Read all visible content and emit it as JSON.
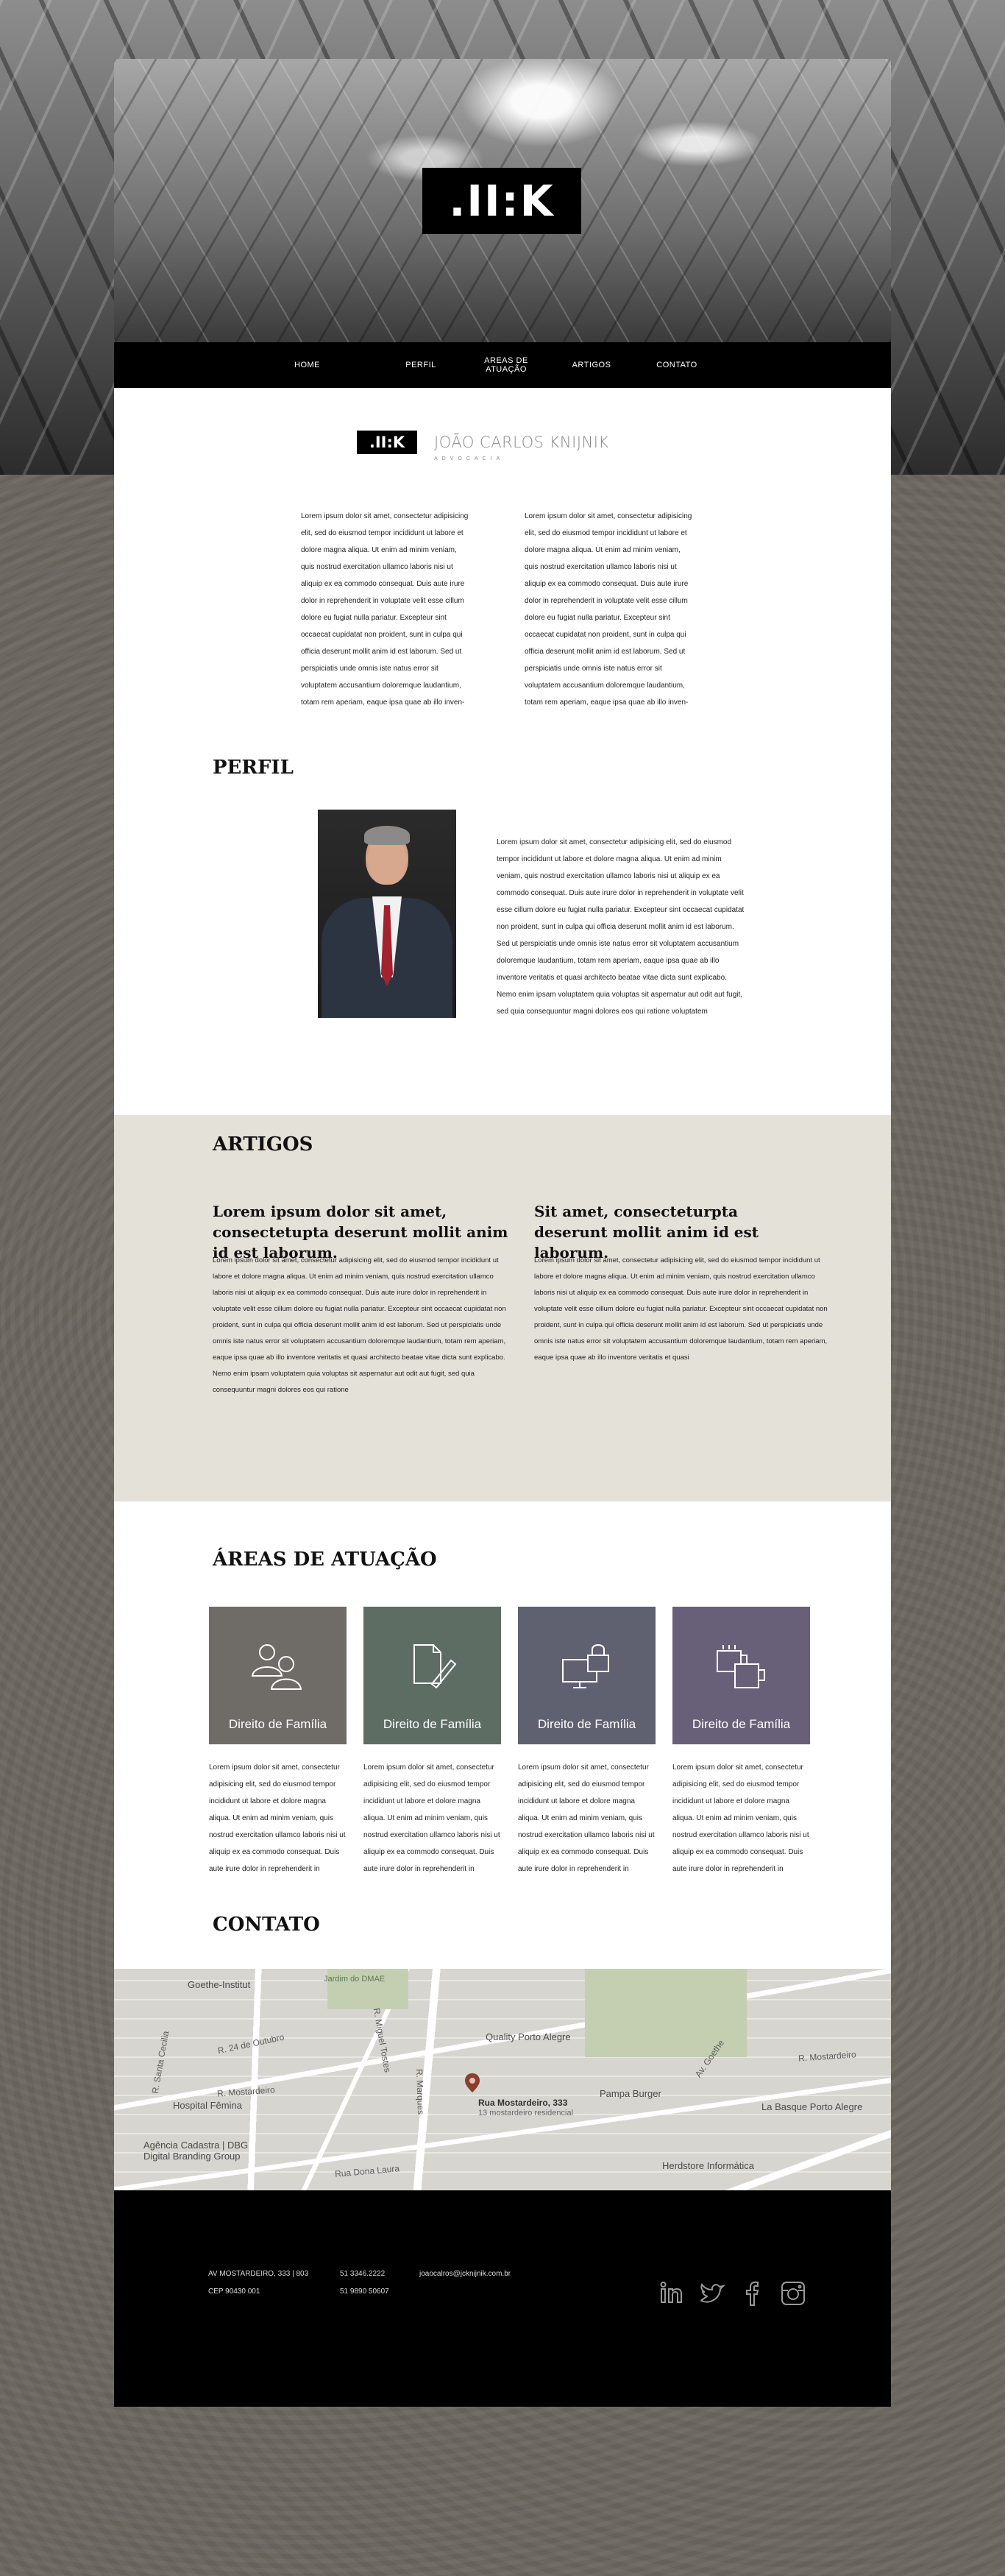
{
  "brand": {
    "logo": ".II:K",
    "name": "JOÃO CARLOS KNIJNIK",
    "subtitle": "ADVOCACIA"
  },
  "nav": [
    "HOME",
    "PERFIL",
    "AREAS DE ATUAÇÃO",
    "ARTIGOS",
    "CONTATO"
  ],
  "intro": {
    "col1": "Lorem ipsum dolor sit amet, consectetur adipisicing elit, sed do eiusmod tempor incididunt ut labore et dolore magna aliqua. Ut enim ad minim veniam, quis nostrud exercitation ullamco laboris nisi ut aliquip ex ea commodo consequat. Duis aute irure dolor in reprehenderit in voluptate velit esse cillum dolore eu fugiat nulla pariatur. Excepteur sint occaecat cupidatat non proident, sunt in culpa qui officia deserunt mollit anim id est laborum. Sed ut perspiciatis unde omnis iste natus error sit voluptatem accusantium doloremque laudantium, totam rem aperiam, eaque ipsa quae ab illo inven-",
    "col2": "Lorem ipsum dolor sit amet, consectetur adipisicing elit, sed do eiusmod tempor incididunt ut labore et dolore magna aliqua. Ut enim ad minim veniam, quis nostrud exercitation ullamco laboris nisi ut aliquip ex ea commodo consequat. Duis aute irure dolor in reprehenderit in voluptate velit esse cillum dolore eu fugiat nulla pariatur. Excepteur sint occaecat cupidatat non proident, sunt in culpa qui officia deserunt mollit anim id est laborum. Sed ut perspiciatis unde omnis iste natus error sit voluptatem accusantium doloremque laudantium, totam rem aperiam, eaque ipsa quae ab illo inven-"
  },
  "perfil": {
    "title": "PERFIL",
    "text": "Lorem ipsum dolor sit amet, consectetur adipisicing elit, sed do eiusmod tempor incididunt ut labore et dolore magna aliqua. Ut enim ad minim veniam, quis nostrud exercitation ullamco laboris nisi ut aliquip ex ea commodo consequat. Duis aute irure dolor in reprehenderit in voluptate velit esse cillum dolore eu fugiat nulla pariatur. Excepteur sint occaecat cupidatat non proident, sunt in culpa qui officia deserunt mollit anim id est laborum. Sed ut perspiciatis unde omnis iste natus error sit voluptatem accusantium doloremque laudantium, totam rem aperiam, eaque ipsa quae ab illo inventore veritatis et quasi architecto beatae vitae dicta sunt explicabo. Nemo enim ipsam voluptatem quia voluptas sit aspernatur aut odit aut fugit, sed quia consequuntur magni dolores eos qui ratione voluptatem"
  },
  "artigos": {
    "title": "ARTIGOS",
    "items": [
      {
        "title": "Lorem ipsum dolor sit amet, consectetupta  deserunt mollit anim id est laborum.",
        "text": "Lorem ipsum dolor sit amet, consectetur adipisicing elit, sed do eiusmod tempor incididunt ut labore et dolore magna aliqua. Ut enim ad minim veniam, quis nostrud exercitation ullamco laboris nisi ut aliquip ex ea commodo consequat. Duis aute irure dolor in reprehenderit in voluptate velit esse cillum dolore eu fugiat nulla pariatur. Excepteur sint occaecat cupidatat non proident, sunt in culpa qui officia deserunt mollit anim id est laborum. Sed ut perspiciatis unde omnis iste natus error sit voluptatem accusantium doloremque laudantium, totam rem aperiam, eaque ipsa quae ab illo inventore veritatis et quasi architecto beatae vitae dicta sunt explicabo. Nemo enim ipsam voluptatem quia voluptas sit aspernatur aut odit aut fugit, sed quia consequuntur magni dolores eos qui ratione"
      },
      {
        "title": "Sit amet, consecteturpta  deserunt mollit anim id est laborum.",
        "text": "Lorem ipsum dolor sit amet, consectetur adipisicing elit, sed do eiusmod tempor incididunt ut labore et dolore magna aliqua. Ut enim ad minim veniam, quis nostrud exercitation ullamco laboris nisi ut aliquip ex ea commodo consequat. Duis aute irure dolor in reprehenderit in voluptate velit esse cillum dolore eu fugiat nulla pariatur. Excepteur sint occaecat cupidatat non proident, sunt in culpa qui officia deserunt mollit anim id est laborum. Sed ut perspiciatis unde omnis iste natus error sit voluptatem accusantium doloremque laudantium, totam rem aperiam, eaque ipsa quae ab illo inventore veritatis et quasi"
      }
    ]
  },
  "areas": {
    "title": "ÁREAS DE ATUAÇÃO",
    "tiles": [
      {
        "label": "Direito de Família",
        "icon": "people-icon",
        "color": "#6f6c67",
        "text": "Lorem ipsum dolor sit amet, consectetur adipisicing elit, sed do eiusmod tempor incididunt ut labore et dolore magna aliqua. Ut enim ad minim veniam, quis nostrud exercitation ullamco laboris nisi ut aliquip ex ea commodo consequat. Duis aute irure dolor in reprehenderit in"
      },
      {
        "label": "Direito de Família",
        "icon": "document-pen-icon",
        "color": "#5d6d63",
        "text": "Lorem ipsum dolor sit amet, consectetur adipisicing elit, sed do eiusmod tempor incididunt ut labore et dolore magna aliqua. Ut enim ad minim veniam, quis nostrud exercitation ullamco laboris nisi ut aliquip ex ea commodo consequat. Duis aute irure dolor in reprehenderit in"
      },
      {
        "label": "Direito de Família",
        "icon": "computer-lock-icon",
        "color": "#5f6170",
        "text": "Lorem ipsum dolor sit amet, consectetur adipisicing elit, sed do eiusmod tempor incididunt ut labore et dolore magna aliqua. Ut enim ad minim veniam, quis nostrud exercitation ullamco laboris nisi ut aliquip ex ea commodo consequat. Duis aute irure dolor in reprehenderit in"
      },
      {
        "label": "Direito de Família",
        "icon": "cups-icon",
        "color": "#686078",
        "text": "Lorem ipsum dolor sit amet, consectetur adipisicing elit, sed do eiusmod tempor incididunt ut labore et dolore magna aliqua. Ut enim ad minim veniam, quis nostrud exercitation ullamco laboris nisi ut aliquip ex ea commodo consequat. Duis aute irure dolor in reprehenderit in"
      }
    ]
  },
  "contato": {
    "title": "CONTATO",
    "map": {
      "pin_title": "Rua Mostardeiro, 333",
      "pin_sub": "13 mostardeiro residencial",
      "labels": [
        "Goethe-Institut",
        "Jardim do DMAE",
        "Quality Porto Alegre",
        "Pampa Burger",
        "La Basque Porto Alegre",
        "Hospital Fêmina",
        "Agência Cadastra | DBG Digital Branding Group",
        "Herdstore Informática"
      ],
      "streets": [
        "R. 24 de Outubro",
        "R. Mostardeiro",
        "Rua Dona Laura",
        "R. Mostardeiro",
        "Av. Goethe",
        "R. Miguel Tostes",
        "R. Marques",
        "R. Santa Cecilia"
      ]
    }
  },
  "footer": {
    "address1": "AV MOSTARDEIRO, 333 | 803",
    "address2": "CEP 90430 001",
    "phone1": "51 3346.2222",
    "phone2": "51 9890 50607",
    "email": "joaocalros@jcknijnik.com.br",
    "social": [
      "linkedin-icon",
      "twitter-icon",
      "facebook-icon",
      "instagram-icon"
    ]
  }
}
